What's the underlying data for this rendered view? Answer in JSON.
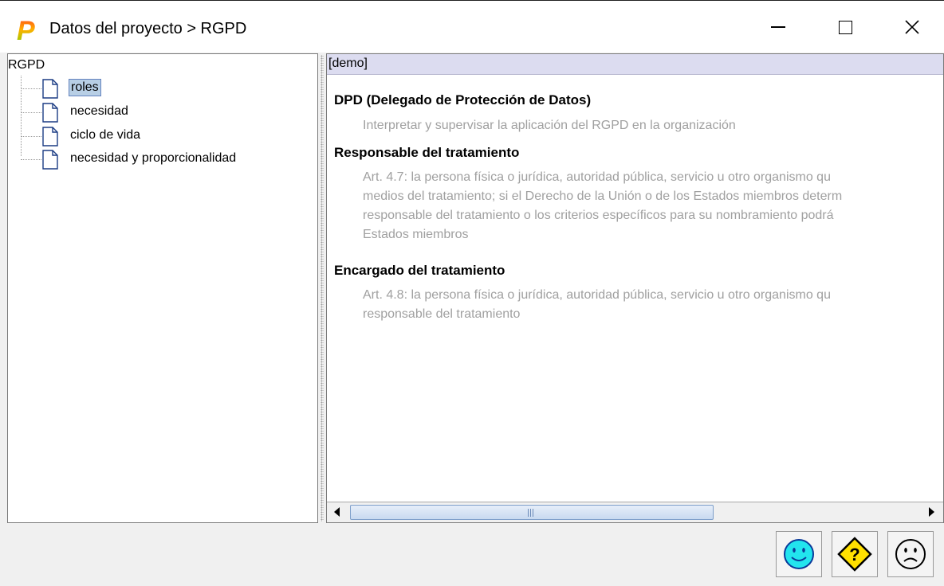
{
  "window": {
    "title": "Datos del proyecto > RGPD",
    "logo_letter": "P"
  },
  "tree": {
    "root": "RGPD",
    "items": [
      {
        "label": "roles",
        "selected": true
      },
      {
        "label": "necesidad",
        "selected": false
      },
      {
        "label": "ciclo de vida",
        "selected": false
      },
      {
        "label": "necesidad y proporcionalidad",
        "selected": false
      }
    ]
  },
  "panel": {
    "header": "[demo]",
    "sections": [
      {
        "title": "DPD (Delegado de Protección de Datos)",
        "body": "Interpretar y supervisar la aplicación del RGPD en la organización"
      },
      {
        "title": "Responsable del tratamiento",
        "body": "Art. 4.7: la persona física o jurídica, autoridad pública, servicio u otro organismo qu\nmedios del tratamiento; si el Derecho de la Unión o de los Estados miembros determ\nresponsable del tratamiento o los criterios específicos para su nombramiento podrá\nEstados miembros"
      },
      {
        "title": "Encargado del tratamiento",
        "body": "Art. 4.8: la persona física o jurídica, autoridad pública, servicio u otro organismo qu\nresponsable del tratamiento"
      }
    ]
  },
  "buttons": {
    "happy_icon": "smiley-happy-icon",
    "help_icon": "help-question-icon",
    "sad_icon": "smiley-sad-icon"
  },
  "colors": {
    "selection": "#b8cfe5",
    "header_bg": "#dcdcf0",
    "body_text": "#a0a0a0",
    "happy_face": "#22e4ee",
    "help_diamond": "#ffe000"
  }
}
